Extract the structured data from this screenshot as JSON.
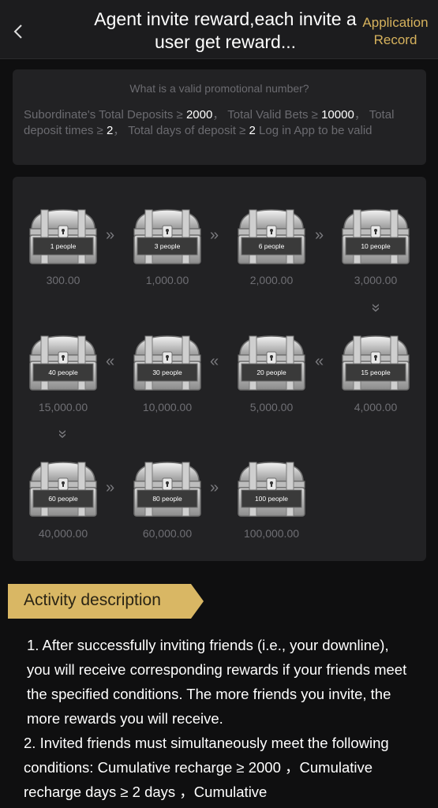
{
  "header": {
    "title": "Agent invite reward,each invite a user get reward...",
    "record_label": "Application Record"
  },
  "info": {
    "question": "What is a valid promotional number?",
    "cond_deposits_label": "Subordinate's Total Deposits ≥",
    "cond_deposits_value": "2000",
    "cond_bets_label": "Total Valid Bets ≥",
    "cond_bets_value": "10000",
    "cond_times_label": "Total deposit times ≥",
    "cond_times_value": "2",
    "cond_days_label": "Total days of deposit ≥",
    "cond_days_value": "2",
    "cond_login": "Log in App to be valid"
  },
  "rewards": [
    {
      "people": "1 people",
      "amount": "300.00"
    },
    {
      "people": "3 people",
      "amount": "1,000.00"
    },
    {
      "people": "6 people",
      "amount": "2,000.00"
    },
    {
      "people": "10 people",
      "amount": "3,000.00"
    },
    {
      "people": "15 people",
      "amount": "4,000.00"
    },
    {
      "people": "20 people",
      "amount": "5,000.00"
    },
    {
      "people": "30 people",
      "amount": "10,000.00"
    },
    {
      "people": "40 people",
      "amount": "15,000.00"
    },
    {
      "people": "60 people",
      "amount": "40,000.00"
    },
    {
      "people": "80 people",
      "amount": "60,000.00"
    },
    {
      "people": "100 people",
      "amount": "100,000.00"
    }
  ],
  "activity": {
    "title": "Activity description",
    "line1": "1. After successfully inviting friends (i.e., your downline), you will receive corresponding rewards if your friends meet the specified conditions. The more friends you invite, the more rewards you will receive.",
    "line2": "2. Invited friends must simultaneously meet the following conditions:  Cumulative recharge ≥ 2000 ，Cumulative recharge days ≥ 2 days ，Cumulative"
  },
  "colors": {
    "accent_gold": "#d6b25d",
    "background": "#0f0f10",
    "card": "#222224"
  }
}
